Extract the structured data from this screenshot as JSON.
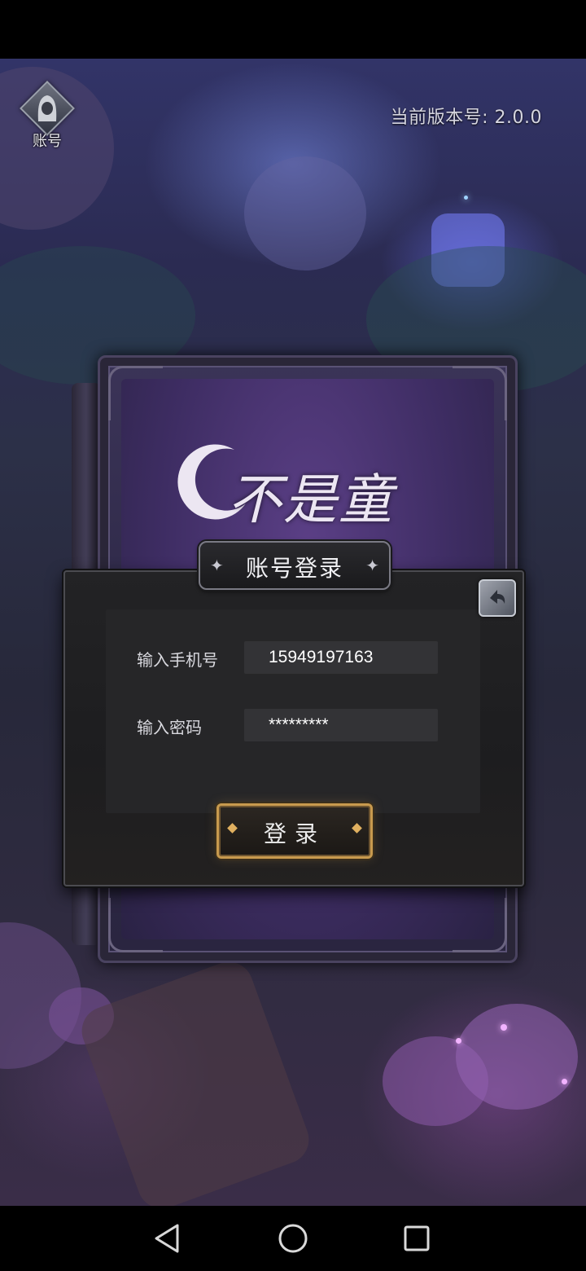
{
  "header": {
    "account_label": "账号",
    "version_text": "当前版本号:  2.0.0"
  },
  "logo": {
    "title_text": "不是童话"
  },
  "login_panel": {
    "title": "账号登录",
    "title_ornament_left": "✦",
    "title_ornament_right": "✦",
    "phone_label": "输入手机号",
    "phone_value": "15949197163",
    "password_label": "输入密码",
    "password_value": "*********",
    "login_button_label": "登录"
  },
  "colors": {
    "panel_bg": "#1d1d1f",
    "input_bg": "#333336",
    "button_border": "#c89a4e",
    "book_cover": "#3e2d63"
  },
  "icons": {
    "account": "hooded-figure-icon",
    "close": "return-arrow-icon",
    "nav_back": "triangle-back-icon",
    "nav_home": "circle-home-icon",
    "nav_recents": "square-recents-icon"
  }
}
